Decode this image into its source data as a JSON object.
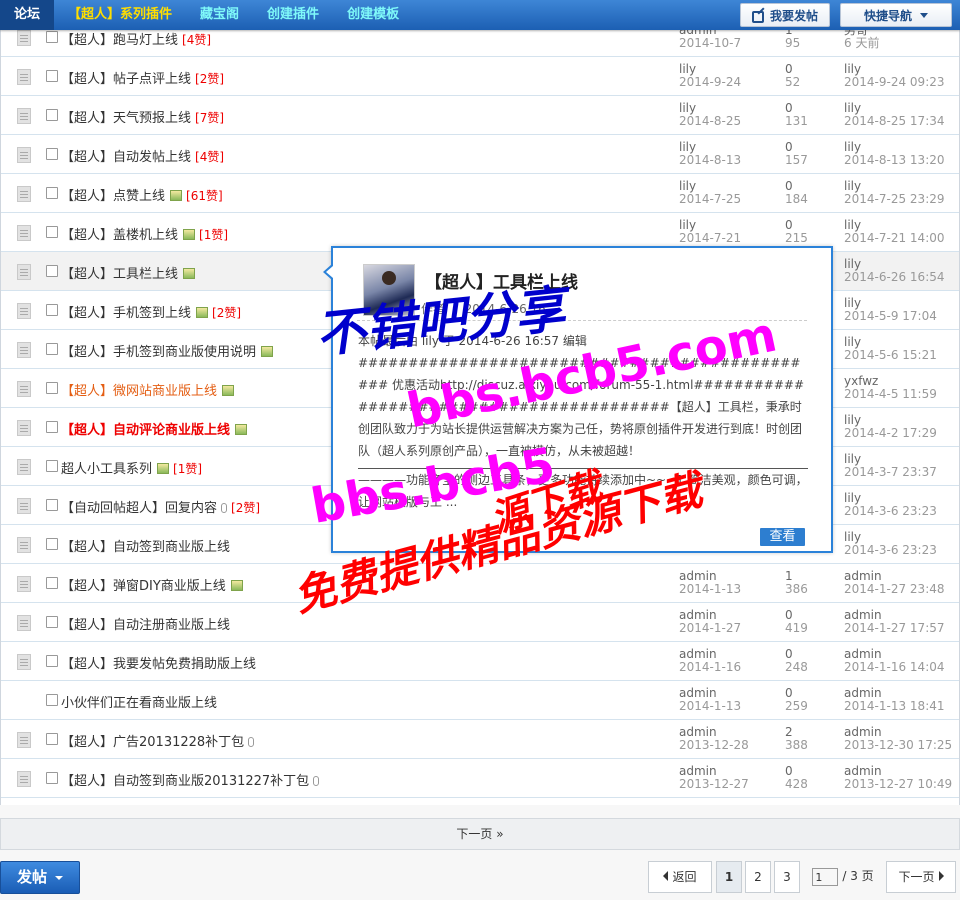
{
  "topbar": {
    "nav": [
      {
        "label": "论坛",
        "style": "home"
      },
      {
        "label": "【超人】系列插件",
        "style": "yellow"
      },
      {
        "label": "藏宝阁",
        "style": "cyan"
      },
      {
        "label": "创建插件",
        "style": "cyan"
      },
      {
        "label": "创建模板",
        "style": "cyan"
      }
    ],
    "post_button": "我要发帖",
    "quick_nav": "快捷导航"
  },
  "threads": [
    {
      "title": "【超人】跑马灯上线",
      "tag": "[4赞]",
      "img": false,
      "clip": false,
      "style": "",
      "author": "admin",
      "date": "2014-10-7",
      "replies": "1",
      "views": "95",
      "last_user": "男哥",
      "last_time": "6 天前"
    },
    {
      "title": "【超人】帖子点评上线",
      "tag": "[2赞]",
      "img": false,
      "clip": false,
      "style": "",
      "author": "lily",
      "date": "2014-9-24",
      "replies": "0",
      "views": "52",
      "last_user": "lily",
      "last_time": "2014-9-24 09:23"
    },
    {
      "title": "【超人】天气预报上线",
      "tag": "[7赞]",
      "img": false,
      "clip": false,
      "style": "",
      "author": "lily",
      "date": "2014-8-25",
      "replies": "0",
      "views": "131",
      "last_user": "lily",
      "last_time": "2014-8-25 17:34"
    },
    {
      "title": "【超人】自动发帖上线",
      "tag": "[4赞]",
      "img": false,
      "clip": false,
      "style": "",
      "author": "lily",
      "date": "2014-8-13",
      "replies": "0",
      "views": "157",
      "last_user": "lily",
      "last_time": "2014-8-13 13:20"
    },
    {
      "title": "【超人】点赞上线",
      "tag": "[61赞]",
      "img": true,
      "clip": false,
      "style": "",
      "author": "lily",
      "date": "2014-7-25",
      "replies": "0",
      "views": "184",
      "last_user": "lily",
      "last_time": "2014-7-25 23:29"
    },
    {
      "title": "【超人】盖楼机上线",
      "tag": "[1赞]",
      "img": true,
      "clip": false,
      "style": "",
      "author": "lily",
      "date": "2014-7-21",
      "replies": "0",
      "views": "215",
      "last_user": "lily",
      "last_time": "2014-7-21 14:00"
    },
    {
      "title": "【超人】工具栏上线",
      "tag": "",
      "img": true,
      "clip": false,
      "style": "hl",
      "author": "",
      "date": "",
      "replies": "",
      "views": "",
      "last_user": "lily",
      "last_time": "2014-6-26 16:54"
    },
    {
      "title": "【超人】手机签到上线",
      "tag": "[2赞]",
      "img": true,
      "clip": false,
      "style": "",
      "author": "",
      "date": "",
      "replies": "",
      "views": "",
      "last_user": "lily",
      "last_time": "2014-5-9 17:04"
    },
    {
      "title": "【超人】手机签到商业版使用说明",
      "tag": "",
      "img": true,
      "clip": false,
      "style": "",
      "author": "",
      "date": "",
      "replies": "",
      "views": "",
      "last_user": "lily",
      "last_time": "2014-5-6 15:21"
    },
    {
      "title": "【超人】微网站商业版上线",
      "tag": "",
      "img": true,
      "clip": false,
      "style": "orange",
      "author": "",
      "date": "",
      "replies": "",
      "views": "",
      "last_user": "yxfwz",
      "last_time": "2014-4-5 11:59"
    },
    {
      "title": "【超人】自动评论商业版上线",
      "tag": "",
      "img": true,
      "clip": false,
      "style": "red",
      "author": "",
      "date": "",
      "replies": "",
      "views": "",
      "last_user": "lily",
      "last_time": "2014-4-2 17:29"
    },
    {
      "title": "超人小工具系列",
      "tag": "[1赞]",
      "img": true,
      "clip": false,
      "style": "",
      "author": "",
      "date": "",
      "replies": "",
      "views": "",
      "last_user": "lily",
      "last_time": "2014-3-7 23:37"
    },
    {
      "title": "【自动回帖超人】回复内容",
      "tag": "[2赞]",
      "img": false,
      "clip": true,
      "style": "",
      "author": "",
      "date": "",
      "replies": "",
      "views": "",
      "last_user": "lily",
      "last_time": "2014-3-6 23:23"
    },
    {
      "title": "【超人】自动签到商业版上线",
      "tag": "",
      "img": false,
      "clip": false,
      "style": "",
      "author": "",
      "date": "",
      "replies": "",
      "views": "",
      "last_user": "lily",
      "last_time": "2014-3-6 23:23"
    },
    {
      "title": "【超人】弹窗DIY商业版上线",
      "tag": "",
      "img": true,
      "clip": false,
      "style": "",
      "author": "admin",
      "date": "2014-1-13",
      "replies": "1",
      "views": "386",
      "last_user": "admin",
      "last_time": "2014-1-27 23:48"
    },
    {
      "title": "【超人】自动注册商业版上线",
      "tag": "",
      "img": false,
      "clip": false,
      "style": "",
      "author": "admin",
      "date": "2014-1-27",
      "replies": "0",
      "views": "419",
      "last_user": "admin",
      "last_time": "2014-1-27 17:57"
    },
    {
      "title": "【超人】我要发帖免费捐助版上线",
      "tag": "",
      "img": false,
      "clip": false,
      "style": "",
      "author": "admin",
      "date": "2014-1-16",
      "replies": "0",
      "views": "248",
      "last_user": "admin",
      "last_time": "2014-1-16 14:04"
    },
    {
      "title": "小伙伴们正在看商业版上线",
      "tag": "",
      "img": false,
      "clip": false,
      "style": "nodoc",
      "author": "admin",
      "date": "2014-1-13",
      "replies": "0",
      "views": "259",
      "last_user": "admin",
      "last_time": "2014-1-13 18:41"
    },
    {
      "title": "【超人】广告20131228补丁包",
      "tag": "",
      "img": false,
      "clip": true,
      "style": "",
      "author": "admin",
      "date": "2013-12-28",
      "replies": "2",
      "views": "388",
      "last_user": "admin",
      "last_time": "2013-12-30 17:25"
    },
    {
      "title": "【超人】自动签到商业版20131227补丁包",
      "tag": "",
      "img": false,
      "clip": true,
      "style": "",
      "author": "admin",
      "date": "2013-12-27",
      "replies": "0",
      "views": "428",
      "last_user": "admin",
      "last_time": "2013-12-27 10:49"
    }
  ],
  "more_label": "下一页 »",
  "popup": {
    "title": "【超人】工具栏上线",
    "meta": "作者 ｜ 2014-6-26 16",
    "edit_note": "本帖最后由 lily 于 2014-6-26 16:57 编辑",
    "body1": "###############################################  优惠活动http://discuz.aixiyou.com/forum-55-1.html##########################################【超人】工具栏，秉承时创团队致力于为站长提供运营解决方案为己任，势将原创插件开发进行到底！时创团队（超人系列原创产品），一直被模仿，从未被超越！",
    "body2": "————功能齐全的侧边工具条，更多功能持续添加中~~~1.简洁美观，颜色可调，让网站模版与工 ...",
    "view_label": "查看"
  },
  "watermarks": [
    "不错吧分享",
    "bbs.bcb5.com",
    "bbs.bcb5",
    "免费提供精品资源下载",
    "源下载"
  ],
  "bottom": {
    "post_label": "发帖",
    "back_label": "返回",
    "pages": [
      "1",
      "2",
      "3"
    ],
    "current_page": "1",
    "page_input": "1",
    "total_pages": "/ 3 页",
    "next_label": "下一页"
  }
}
